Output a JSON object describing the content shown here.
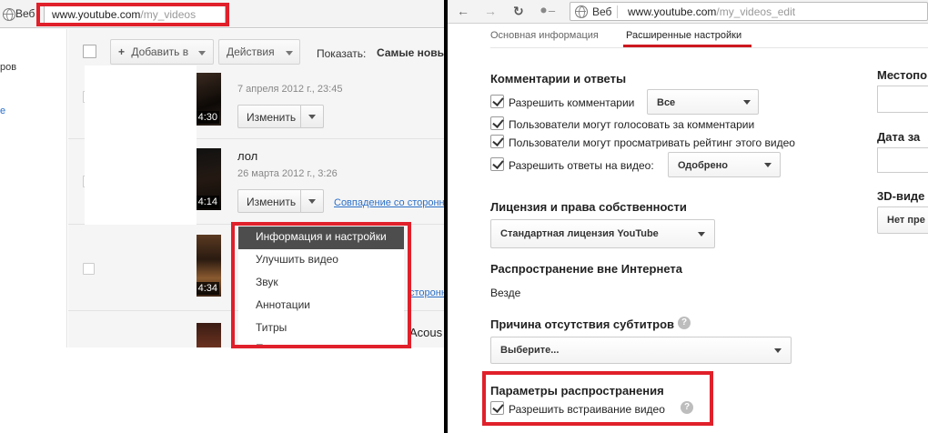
{
  "left": {
    "browser": {
      "web_label": "Веб",
      "url_host": "www.youtube.com",
      "url_path": "/my_videos"
    },
    "sidebar": {
      "text_1": "ров",
      "text_2": "е"
    },
    "toolbar": {
      "add_label": "Добавить в",
      "actions_label": "Действия",
      "show_label": "Показать:",
      "sort_value": "Самые новы"
    },
    "videos": [
      {
        "title": "",
        "date": "7 апреля 2012 г., 23:45",
        "duration": "4:30",
        "edit_label": "Изменить",
        "link": ""
      },
      {
        "title": "лол",
        "date": "26 марта 2012 г., 3:26",
        "duration": "4:14",
        "edit_label": "Изменить",
        "link": "Совпадение со сторонн"
      },
      {
        "title": "",
        "date": "",
        "duration": "4:34",
        "edit_label": "",
        "link": "сторонн"
      },
      {
        "title": "Acous",
        "date": "",
        "duration": "",
        "edit_label": "",
        "link": ""
      }
    ],
    "menu": {
      "items": [
        "Информация и настройки",
        "Улучшить видео",
        "Звук",
        "Аннотации",
        "Титры",
        "Продвижение"
      ]
    }
  },
  "right": {
    "browser": {
      "web_label": "Веб",
      "url_host": "www.youtube.com",
      "url_path": "/my_videos_edit"
    },
    "tabs": [
      {
        "label": "Основная информация",
        "active": false
      },
      {
        "label": "Расширенные настройки",
        "active": true
      }
    ],
    "comments": {
      "heading": "Комментарии и ответы",
      "allow_comments_label": "Разрешить комментарии",
      "allow_comments_select": "Все",
      "vote_label": "Пользователи могут голосовать за комментарии",
      "rating_label": "Пользователи могут просматривать рейтинг этого видео",
      "video_replies_label": "Разрешить ответы на видео:",
      "video_replies_select": "Одобрено"
    },
    "license": {
      "heading": "Лицензия и права собственности",
      "select": "Стандартная лицензия YouTube"
    },
    "offline": {
      "heading": "Распространение вне Интернета",
      "value": "Везде"
    },
    "captions": {
      "heading": "Причина отсутствия субтитров",
      "select": "Выберите..."
    },
    "distribution": {
      "heading": "Параметры распространения",
      "embed_label": "Разрешить встраивание видео"
    },
    "side": {
      "location_label": "Местопо",
      "date_label": "Дата за",
      "video3d_label": "3D-виде",
      "video3d_select": "Нет пре"
    },
    "colors": {
      "highlight_red": "#e0202a",
      "tab_underline": "#cc181e"
    }
  }
}
